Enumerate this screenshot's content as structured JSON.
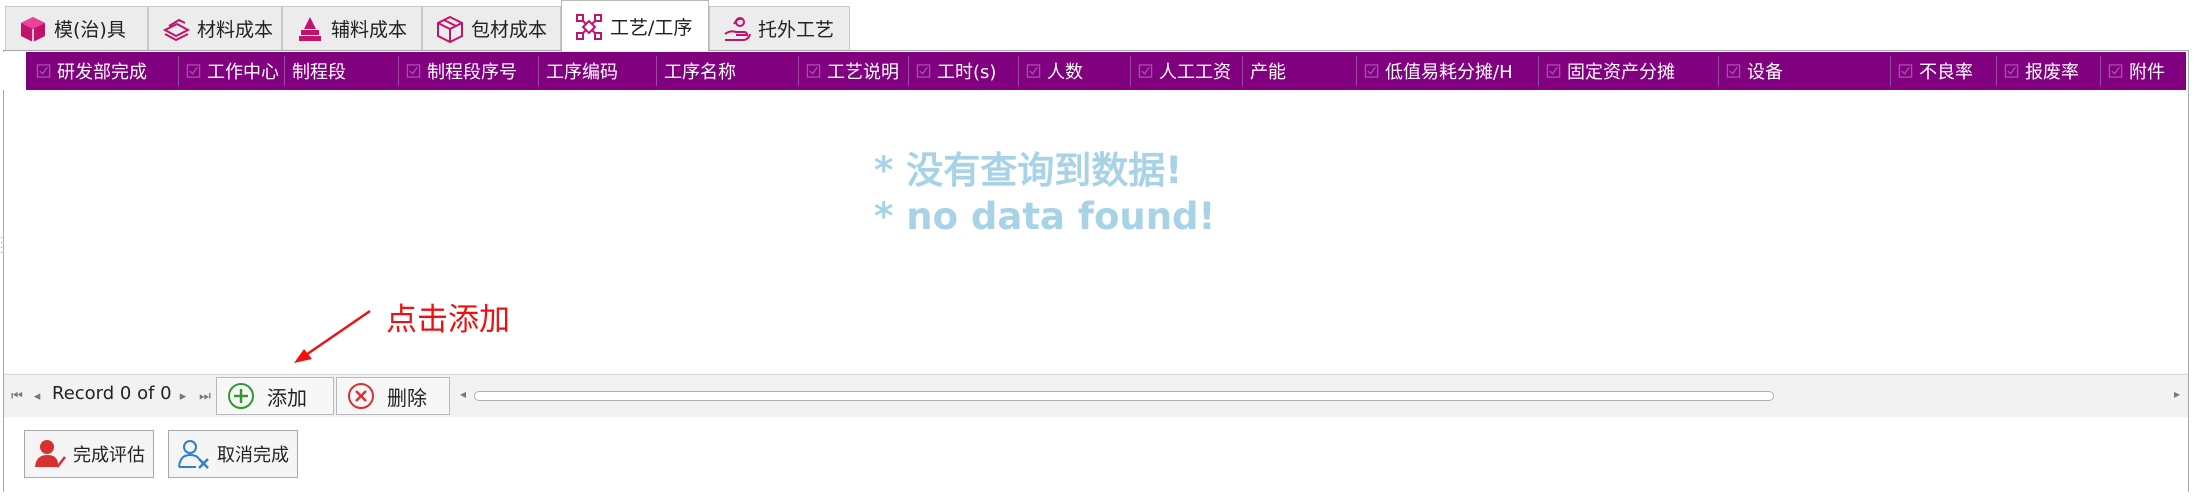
{
  "tabs": [
    {
      "label": "模(治)具",
      "icon": "cube-icon"
    },
    {
      "label": "材料成本",
      "icon": "material-stack-icon"
    },
    {
      "label": "辅料成本",
      "icon": "auxiliary-stack-icon"
    },
    {
      "label": "包材成本",
      "icon": "package-icon"
    },
    {
      "label": "工艺/工序",
      "icon": "process-nodes-icon",
      "active": true
    },
    {
      "label": "托外工艺",
      "icon": "outsource-hand-icon"
    }
  ],
  "grid": {
    "columns": [
      {
        "label": "研发部完成",
        "checkbox": true
      },
      {
        "label": "工作中心",
        "checkbox": true
      },
      {
        "label": "制程段",
        "checkbox": false
      },
      {
        "label": "制程段序号",
        "checkbox": true
      },
      {
        "label": "工序编码",
        "checkbox": false
      },
      {
        "label": "工序名称",
        "checkbox": false
      },
      {
        "label": "工艺说明",
        "checkbox": true
      },
      {
        "label": "工时(s)",
        "checkbox": true
      },
      {
        "label": "人数",
        "checkbox": true
      },
      {
        "label": "人工工资",
        "checkbox": true
      },
      {
        "label": "产能",
        "checkbox": false
      },
      {
        "label": "低值易耗分摊/H",
        "checkbox": true
      },
      {
        "label": "固定资产分摊",
        "checkbox": true
      },
      {
        "label": "设备",
        "checkbox": true
      },
      {
        "label": "不良率",
        "checkbox": true
      },
      {
        "label": "报废率",
        "checkbox": true
      },
      {
        "label": "附件",
        "checkbox": true
      }
    ],
    "empty_line1": "* 没有查询到数据!",
    "empty_line2": "* no data found!",
    "header_color": "#800080"
  },
  "annotation": {
    "text": "点击添加",
    "color": "#ee1111"
  },
  "navigator": {
    "record_text": "Record 0 of 0",
    "add_label": "添加",
    "delete_label": "删除"
  },
  "bottom_buttons": {
    "complete_label": "完成评估",
    "cancel_label": "取消完成"
  }
}
